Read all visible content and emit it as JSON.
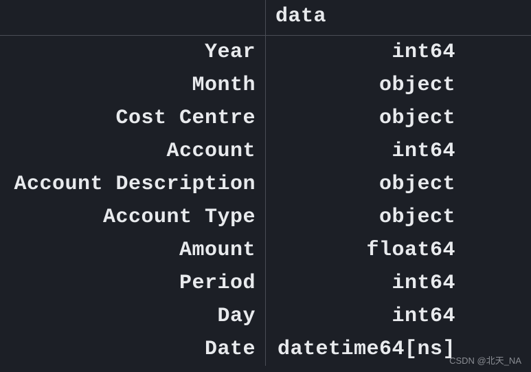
{
  "header": {
    "index_label": "",
    "data_label": "data"
  },
  "rows": [
    {
      "name": "Year",
      "dtype": "int64"
    },
    {
      "name": "Month",
      "dtype": "object"
    },
    {
      "name": "Cost Centre",
      "dtype": "object"
    },
    {
      "name": "Account",
      "dtype": "int64"
    },
    {
      "name": "Account Description",
      "dtype": "object"
    },
    {
      "name": "Account Type",
      "dtype": "object"
    },
    {
      "name": "Amount",
      "dtype": "float64"
    },
    {
      "name": "Period",
      "dtype": "int64"
    },
    {
      "name": "Day",
      "dtype": "int64"
    },
    {
      "name": "Date",
      "dtype": "datetime64[ns]"
    }
  ],
  "watermark": "CSDN @北天_NA"
}
